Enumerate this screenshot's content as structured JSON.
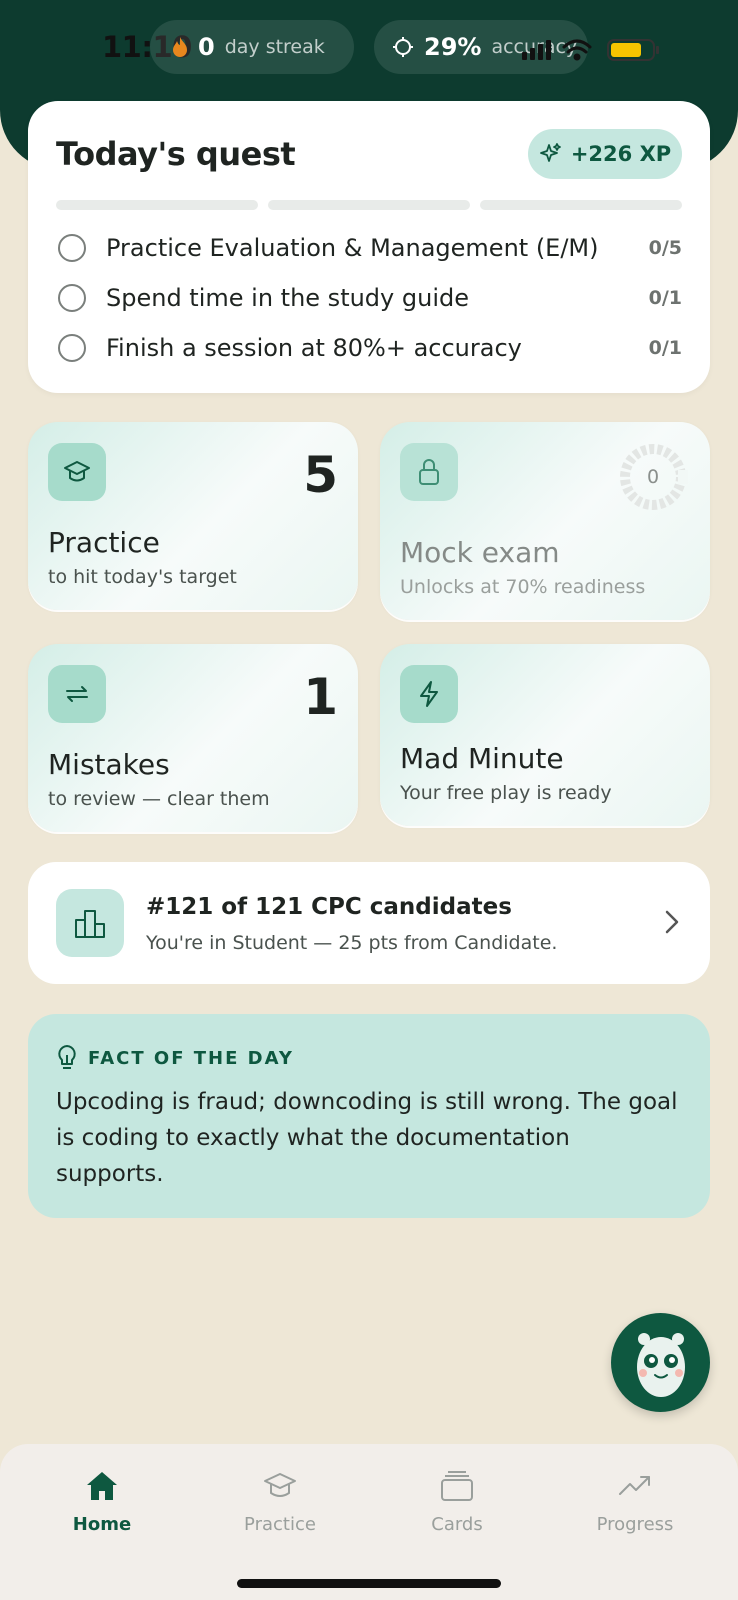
{
  "status_bar": {
    "time": "11:10"
  },
  "header": {
    "streak": {
      "value": "0",
      "label": "day streak",
      "icon": "flame-icon"
    },
    "accuracy": {
      "value": "29%",
      "label": "accuracy",
      "icon": "crosshair-icon"
    }
  },
  "quest": {
    "title": "Today's quest",
    "xp": "+226 XP",
    "tasks": [
      {
        "label": "Practice Evaluation & Management (E/M)",
        "count": "0/5"
      },
      {
        "label": "Spend time in the study guide",
        "count": "0/1"
      },
      {
        "label": "Finish a session at 80%+ accuracy",
        "count": "0/1"
      }
    ]
  },
  "tiles": {
    "practice": {
      "number": "5",
      "title": "Practice",
      "subtitle": "to hit today's target",
      "icon": "graduation-cap-icon"
    },
    "mock_exam": {
      "ring_value": "0",
      "title": "Mock exam",
      "subtitle": "Unlocks at 70% readiness",
      "icon": "lock-icon"
    },
    "mistakes": {
      "number": "1",
      "title": "Mistakes",
      "subtitle": "to review — clear them",
      "icon": "repeat-icon"
    },
    "mad_minute": {
      "title": "Mad Minute",
      "subtitle": "Your free play is ready",
      "icon": "lightning-icon"
    }
  },
  "rank": {
    "title": "#121 of 121 CPC candidates",
    "subtitle": "You're in Student — 25 pts from Candidate.",
    "icon": "podium-chart-icon"
  },
  "fact": {
    "heading": "FACT OF THE DAY",
    "text": "Upcoding is fraud; downcoding is still wrong. The goal is coding to exactly what the documentation supports.",
    "icon": "lightbulb-icon"
  },
  "tabbar": {
    "tabs": [
      {
        "label": "Home",
        "icon": "home-icon",
        "active": true
      },
      {
        "label": "Practice",
        "icon": "graduation-cap-icon",
        "active": false
      },
      {
        "label": "Cards",
        "icon": "cards-icon",
        "active": false
      },
      {
        "label": "Progress",
        "icon": "trend-up-icon",
        "active": false
      }
    ]
  },
  "colors": {
    "brand_dark": "#0d3b2f",
    "accent": "#0e5840",
    "mint": "#c5e7df",
    "background": "#eee7d6"
  }
}
